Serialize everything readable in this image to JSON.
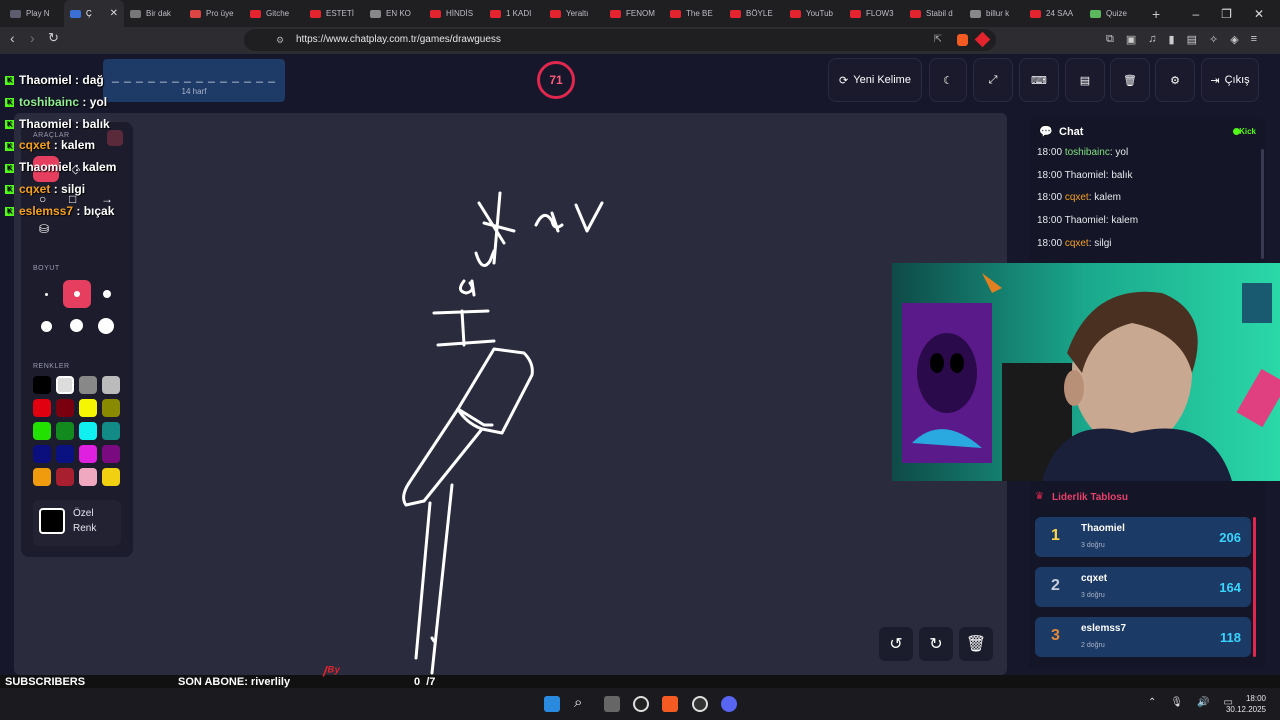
{
  "tabs": [
    {
      "label": "Play N",
      "color": "#5d5d6d",
      "active": false
    },
    {
      "label": "Ç",
      "color": "#3b6fd6",
      "active": true
    },
    {
      "label": "Bir dak",
      "color": "#777",
      "active": false
    },
    {
      "label": "Pro üye",
      "color": "#d44",
      "active": false
    },
    {
      "label": "Gitche",
      "color": "#e3232d",
      "active": false
    },
    {
      "label": "ESTETİ",
      "color": "#e3232d",
      "active": false
    },
    {
      "label": "EN KO",
      "color": "#888",
      "active": false
    },
    {
      "label": "HİNDİS",
      "color": "#e3232d",
      "active": false
    },
    {
      "label": "1 KADI",
      "color": "#e3232d",
      "active": false
    },
    {
      "label": "Yeraltı",
      "color": "#e3232d",
      "active": false
    },
    {
      "label": "FENOM",
      "color": "#e3232d",
      "active": false
    },
    {
      "label": "The BE",
      "color": "#e3232d",
      "active": false
    },
    {
      "label": "BÖYLE",
      "color": "#e3232d",
      "active": false
    },
    {
      "label": "YouTub",
      "color": "#e3232d",
      "active": false
    },
    {
      "label": "FLOW3",
      "color": "#e3232d",
      "active": false
    },
    {
      "label": "Stabil d",
      "color": "#e3232d",
      "active": false
    },
    {
      "label": "billur k",
      "color": "#888",
      "active": false
    },
    {
      "label": "24 SAA",
      "color": "#e3232d",
      "active": false
    },
    {
      "label": "Quize",
      "color": "#5cb85c",
      "active": false
    }
  ],
  "browser": {
    "url": "https://www.chatplay.com.tr/games/drawguess",
    "new_tab": "+",
    "minimize": "–",
    "restore": "❐",
    "close": "✕"
  },
  "game": {
    "word_dashes": "_ _ _ _ _ _ _ _ _ _ _ _ _ _",
    "word_letters": "14 harf",
    "timer": "71",
    "new_word_label": "Yeni Kelime",
    "exit_label": "Çıkış"
  },
  "tools": {
    "section_tools": "ARAÇLAR",
    "section_size": "BOYUT",
    "section_colors": "RENKLER",
    "custom_color_label_1": "Özel",
    "custom_color_label_2": "Renk",
    "swatches": [
      "#000000",
      "#dcdcdc",
      "#888888",
      "#bbbbbb",
      "#e0000f",
      "#7a0010",
      "#f6f600",
      "#8a8a00",
      "#22e000",
      "#138a1e",
      "#10f0f0",
      "#128a86",
      "#0a0f7d",
      "#0a1180",
      "#e020e0",
      "#7a0a80",
      "#f09a0e",
      "#a82030",
      "#f0a8c0",
      "#f0d010"
    ]
  },
  "stream_chat": [
    {
      "user": "Thaomiel",
      "msg": "dağ",
      "color": "#ffffff"
    },
    {
      "user": "toshibainc",
      "msg": "yol",
      "color": "#90ee90"
    },
    {
      "user": "Thaomiel",
      "msg": "balık",
      "color": "#ffffff"
    },
    {
      "user": "cqxet",
      "msg": "kalem",
      "color": "#f4a020"
    },
    {
      "user": "Thaomiel",
      "msg": "kalem",
      "color": "#ffffff"
    },
    {
      "user": "cqxet",
      "msg": "silgi",
      "color": "#f4a020"
    },
    {
      "user": "eslemss7",
      "msg": "bıçak",
      "color": "#f4a020"
    }
  ],
  "chat_panel": {
    "title": "Chat",
    "source": "Kick",
    "messages": [
      {
        "time": "18:00",
        "user": "toshibainc",
        "msg": "yol",
        "color": "#7fe07f"
      },
      {
        "time": "18:00",
        "user": "Thaomiel",
        "msg": "balık",
        "color": "#e8e8ee"
      },
      {
        "time": "18:00",
        "user": "cqxet",
        "msg": "kalem",
        "color": "#f4a020"
      },
      {
        "time": "18:00",
        "user": "Thaomiel",
        "msg": "kalem",
        "color": "#e8e8ee"
      },
      {
        "time": "18:00",
        "user": "cqxet",
        "msg": "silgi",
        "color": "#f4a020"
      }
    ]
  },
  "leaderboard": {
    "title": "Liderlik Tablosu",
    "entries": [
      {
        "rank": "1",
        "name": "Thaomiel",
        "sub": "3 doğru",
        "score": "206",
        "rank_color": "#ffd54a"
      },
      {
        "rank": "2",
        "name": "cqxet",
        "sub": "3 doğru",
        "score": "164",
        "rank_color": "#c8cfdc"
      },
      {
        "rank": "3",
        "name": "eslemss7",
        "sub": "2 doğru",
        "score": "118",
        "rank_color": "#e08a3a"
      }
    ]
  },
  "stream_bar": {
    "subscribers_label": "SUBSCRIBERS",
    "last_sub": "SON ABONE: riverlily",
    "count": "0  /7"
  },
  "taskbar": {
    "time": "18:00",
    "date": "30.12.2025"
  }
}
